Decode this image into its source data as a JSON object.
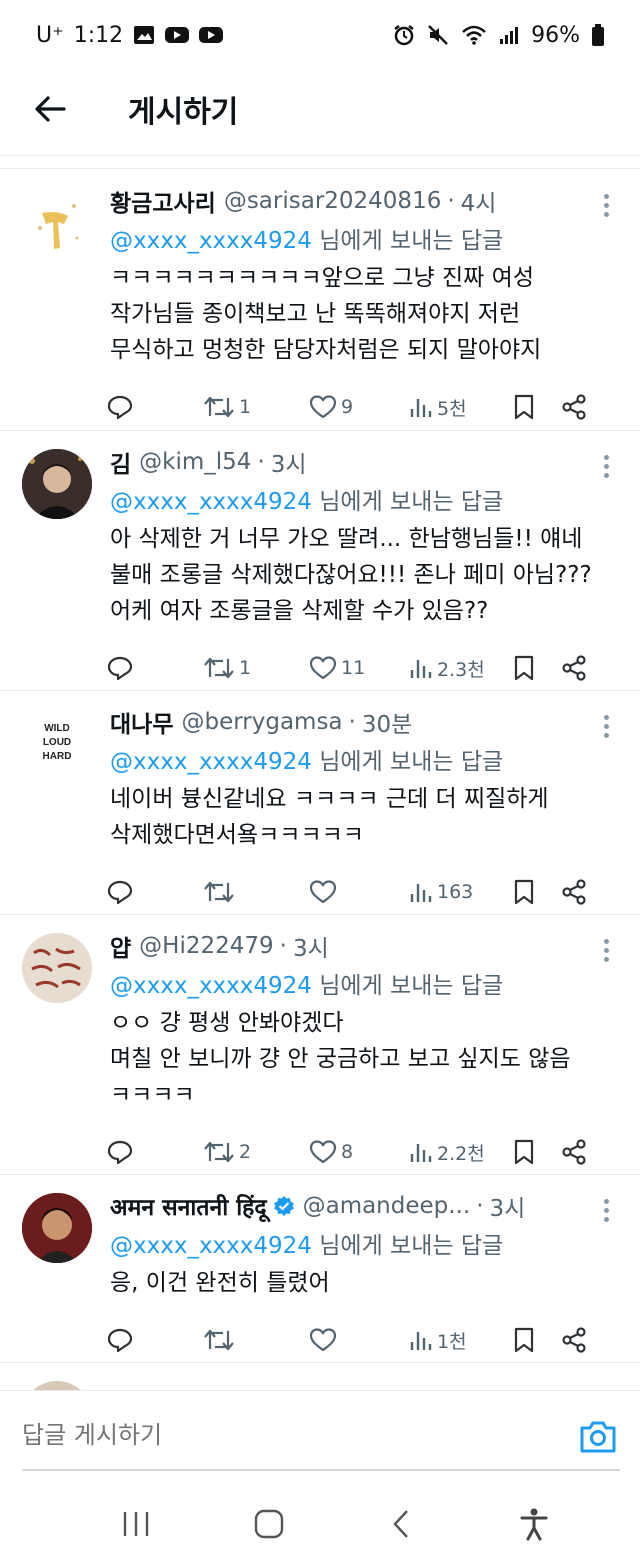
{
  "status_bar": {
    "carrier": "U⁺",
    "time": "1:12",
    "battery": "96%"
  },
  "header": {
    "title": "게시하기"
  },
  "replies": [
    {
      "name": "황금고사리",
      "handle": "@sarisar20240816",
      "time": "4시",
      "reply_to_handle": "@xxxx_xxxx4924",
      "reply_to_suffix": "님에게 보내는 답글",
      "text": "ㅋㅋㅋㅋㅋㅋㅋㅋㅋㅋ앞으로 그냥 진짜 여성\n작가님들 종이책보고 난 똑똑해져야지 저런\n무식하고 멍청한 담당자처럼은 되지 말아야지",
      "retweets": "1",
      "likes": "9",
      "views": "5천"
    },
    {
      "name": "김",
      "handle": "@kim_l54",
      "time": "3시",
      "reply_to_handle": "@xxxx_xxxx4924",
      "reply_to_suffix": "님에게 보내는 답글",
      "text": "아 삭제한 거 너무 가오 딸려... 한남행님들!! 얘네\n불매 조롱글 삭제했다잖어요!!! 존나 페미 아님???\n어케 여자 조롱글을 삭제할 수가 있음??",
      "retweets": "1",
      "likes": "11",
      "views": "2.3천"
    },
    {
      "name": "대나무",
      "handle": "@berrygamsa",
      "time": "30분",
      "reply_to_handle": "@xxxx_xxxx4924",
      "reply_to_suffix": "님에게 보내는 답글",
      "text": "네이버 븅신같네요 ㅋㅋㅋㅋ 근데 더 찌질하게\n삭제했다면서욬ㅋㅋㅋㅋㅋ",
      "retweets": "",
      "likes": "",
      "views": "163"
    },
    {
      "name": "얍",
      "handle": "@Hi222479",
      "time": "3시",
      "reply_to_handle": "@xxxx_xxxx4924",
      "reply_to_suffix": "님에게 보내는 답글",
      "text": "ㅇㅇ 걍 평생 안봐야겠다\n며칠 안 보니까 걍 안 궁금하고 보고 싶지도 않음\nㅋㅋㅋㅋ",
      "retweets": "2",
      "likes": "8",
      "views": "2.2천"
    },
    {
      "name": "अमन सनातनी हिंदू",
      "handle": "@amandeep...",
      "time": "3시",
      "reply_to_handle": "@xxxx_xxxx4924",
      "reply_to_suffix": "님에게 보내는 답글",
      "text": "응, 이건 완전히 틀렸어",
      "retweets": "",
      "likes": "",
      "views": "1천"
    }
  ],
  "composer": {
    "placeholder": "답글 게시하기"
  },
  "colors": {
    "accent": "#1d9bf0",
    "secondary_text": "#536471",
    "divider": "#e6ecf0"
  },
  "icons": [
    "back-arrow-icon",
    "reply-icon",
    "retweet-icon",
    "heart-icon",
    "views-icon",
    "bookmark-icon",
    "share-icon",
    "more-icon",
    "verified-icon",
    "camera-icon",
    "recents-icon",
    "home-icon",
    "back-nav-icon",
    "accessibility-icon"
  ]
}
